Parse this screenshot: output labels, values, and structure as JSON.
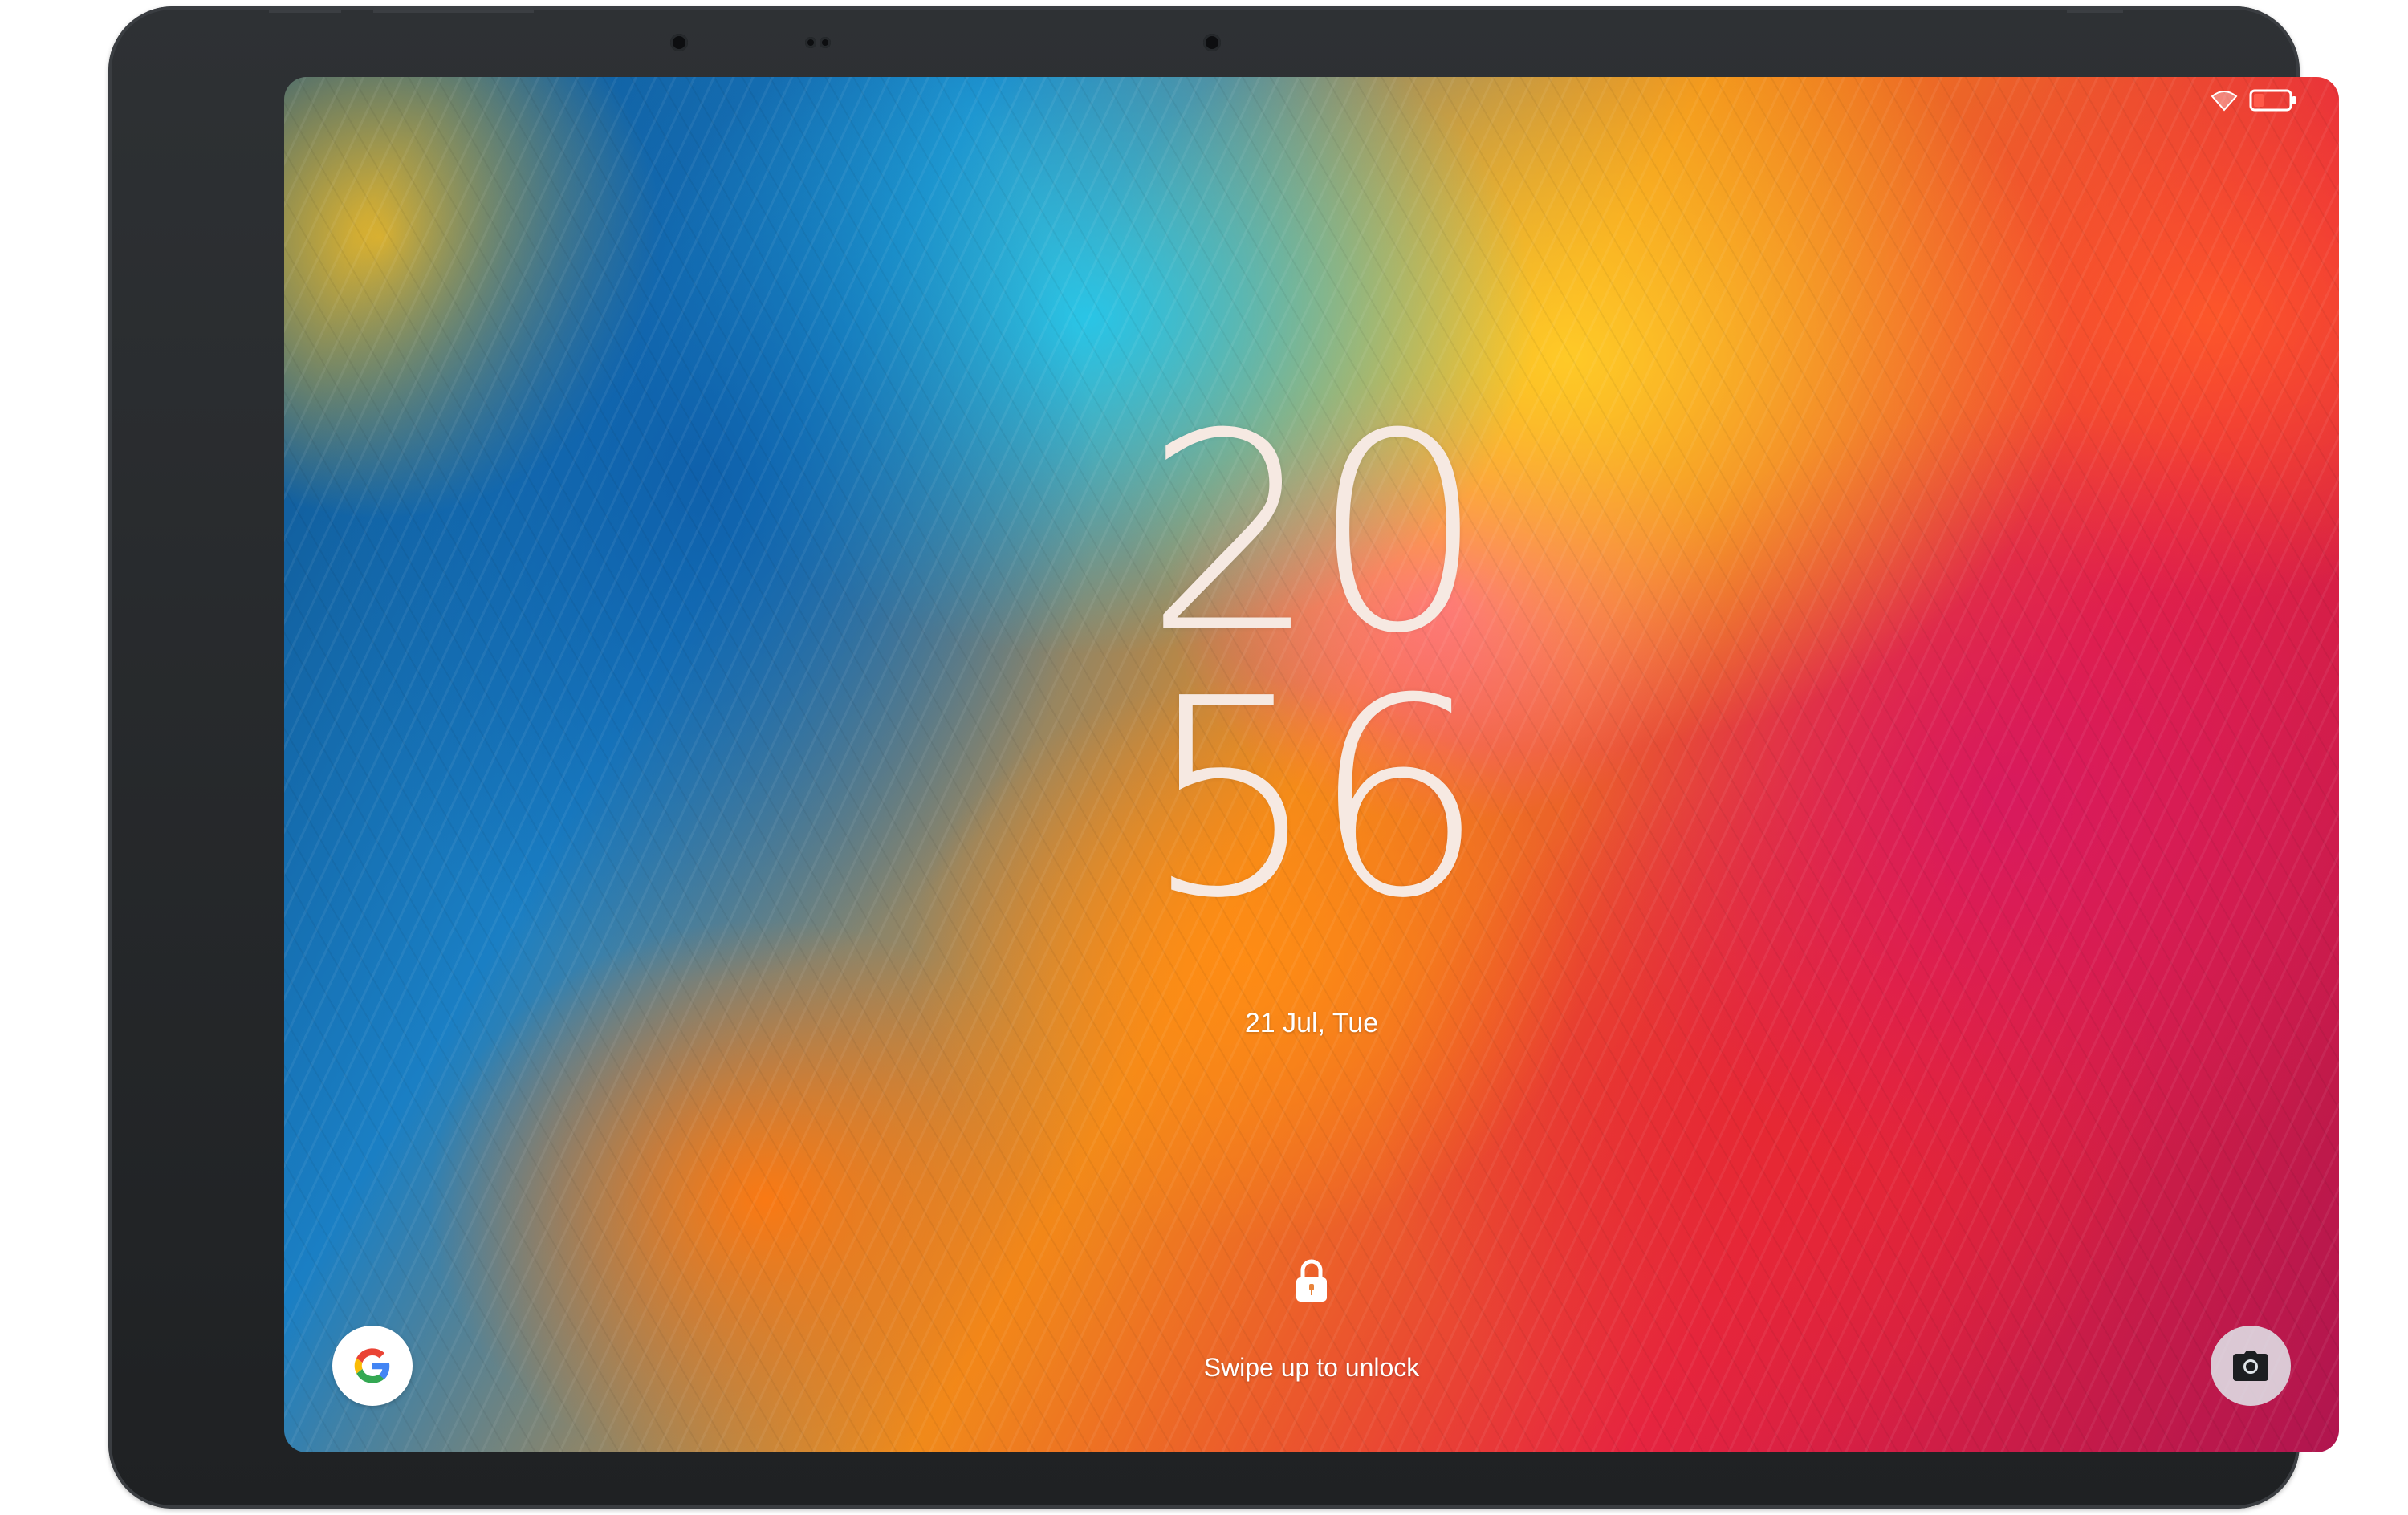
{
  "lock_screen": {
    "clock_hours": "20",
    "clock_minutes": "56",
    "date": "21 Jul, Tue",
    "unlock_hint": "Swipe up to unlock"
  },
  "status_bar": {
    "icons": [
      "wifi-icon",
      "battery-icon"
    ]
  },
  "shortcuts": {
    "left": "google-icon",
    "right": "camera-icon"
  },
  "colors": {
    "clock_text": "#f6e9e2",
    "bezel": "#2e3134",
    "google_blue": "#4285F4",
    "google_red": "#EA4335",
    "google_yellow": "#FBBC05",
    "google_green": "#34A853"
  }
}
